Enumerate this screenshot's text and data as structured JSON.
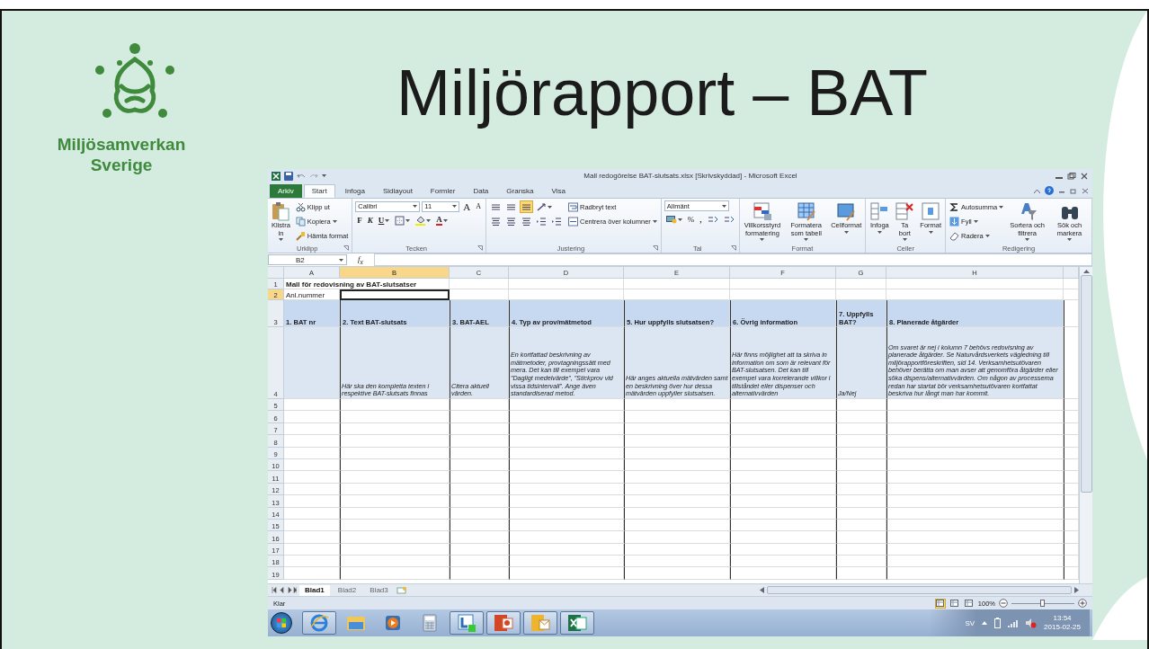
{
  "slide": {
    "logo_lines": [
      "Miljösamverkan",
      "Sverige"
    ],
    "title": "Miljörapport – BAT"
  },
  "excel": {
    "title": "Mall redogörelse BAT-slutsats.xlsx [Skrivskyddad] - Microsoft Excel",
    "ribbon_tabs": [
      {
        "label": "Arkiv",
        "kind": "file",
        "selected": false
      },
      {
        "label": "Start",
        "kind": "tab",
        "selected": true
      },
      {
        "label": "Infoga",
        "kind": "tab",
        "selected": false
      },
      {
        "label": "Sidlayout",
        "kind": "tab",
        "selected": false
      },
      {
        "label": "Formler",
        "kind": "tab",
        "selected": false
      },
      {
        "label": "Data",
        "kind": "tab",
        "selected": false
      },
      {
        "label": "Granska",
        "kind": "tab",
        "selected": false
      },
      {
        "label": "Visa",
        "kind": "tab",
        "selected": false
      }
    ],
    "ribbon_groups": [
      {
        "label": "Urklipp",
        "launcher": true,
        "columns": [
          [
            {
              "kind": "large",
              "label": "Klistra in",
              "dropdown": true
            }
          ],
          [
            {
              "kind": "small",
              "label": "Klipp ut",
              "dropdown": false
            },
            {
              "kind": "small",
              "label": "Kopiera",
              "dropdown": true
            },
            {
              "kind": "small",
              "label": "Hämta format",
              "dropdown": false
            }
          ]
        ]
      },
      {
        "label": "Tecken",
        "launcher": true,
        "columns": [
          [
            {
              "kind": "row",
              "items": [
                {
                  "kind": "field",
                  "value": "Calibri"
                },
                {
                  "kind": "field",
                  "value": "11"
                },
                {
                  "kind": "grow",
                  "text": "A",
                  "dropdown": false
                },
                {
                  "kind": "shrink",
                  "text": "A",
                  "dropdown": false
                }
              ]
            },
            {
              "kind": "row",
              "items": [
                {
                  "kind": "bold",
                  "text": "F",
                  "dropdown": false
                },
                {
                  "kind": "italic",
                  "text": "K",
                  "dropdown": false
                },
                {
                  "kind": "underline",
                  "text": "U",
                  "dropdown": true
                },
                {
                  "kind": "borders",
                  "dropdown": true
                },
                {
                  "kind": "fill",
                  "dropdown": true
                },
                {
                  "kind": "fontcolor",
                  "text": "A",
                  "dropdown": true
                }
              ]
            }
          ]
        ]
      },
      {
        "label": "Justering",
        "launcher": true,
        "columns": [
          [
            {
              "kind": "row",
              "items": [
                {
                  "kind": "valign",
                  "selected": false
                },
                {
                  "kind": "valign",
                  "selected": false
                },
                {
                  "kind": "valign",
                  "selected": true
                },
                {
                  "kind": "orientation",
                  "dropdown": true
                }
              ]
            },
            {
              "kind": "row",
              "items": [
                {
                  "kind": "halign"
                },
                {
                  "kind": "halign"
                },
                {
                  "kind": "halign"
                },
                {
                  "kind": "indent"
                },
                {
                  "kind": "indent"
                }
              ]
            }
          ],
          [
            {
              "kind": "small",
              "label": "Radbryt text",
              "dropdown": false
            },
            {
              "kind": "small",
              "label": "Centrera över kolumner",
              "dropdown": true
            }
          ]
        ]
      },
      {
        "label": "Tal",
        "launcher": true,
        "columns": [
          [
            {
              "kind": "field",
              "value": "Allmänt"
            },
            {
              "kind": "row",
              "items": [
                {
                  "kind": "currency",
                  "dropdown": true
                },
                {
                  "kind": "percent",
                  "text": "%",
                  "dropdown": false
                },
                {
                  "kind": "comma",
                  "text": ",",
                  "dropdown": false
                },
                {
                  "kind": "decimals"
                },
                {
                  "kind": "decimals"
                }
              ]
            }
          ]
        ]
      },
      {
        "label": "Format",
        "launcher": false,
        "columns": [
          [
            {
              "kind": "large",
              "label": "Villkorsstyrd formatering",
              "dropdown": true
            }
          ],
          [
            {
              "kind": "large",
              "label": "Formatera som tabell",
              "dropdown": true
            }
          ],
          [
            {
              "kind": "large",
              "label": "Cellformat",
              "dropdown": true
            }
          ]
        ]
      },
      {
        "label": "Celler",
        "launcher": false,
        "columns": [
          [
            {
              "kind": "large",
              "label": "Infoga",
              "dropdown": true
            }
          ],
          [
            {
              "kind": "large",
              "label": "Ta bort",
              "dropdown": true
            }
          ],
          [
            {
              "kind": "large",
              "label": "Format",
              "dropdown": true
            }
          ]
        ]
      },
      {
        "label": "Redigering",
        "launcher": false,
        "columns": [
          [
            {
              "kind": "small",
              "label": "Autosumma",
              "dropdown": true
            },
            {
              "kind": "small",
              "label": "Fyll",
              "dropdown": true
            },
            {
              "kind": "small",
              "label": "Radera",
              "dropdown": true
            }
          ],
          [
            {
              "kind": "large",
              "label": "Sortera och filtrera",
              "dropdown": true
            }
          ],
          [
            {
              "kind": "large",
              "label": "Sök och markera",
              "dropdown": true
            }
          ]
        ]
      }
    ],
    "formula_bar": {
      "name_box": "B2",
      "fx": "f$_{x}$"
    },
    "sheet": {
      "columns": [
        {
          "label": "A",
          "selected": false
        },
        {
          "label": "B",
          "selected": true
        },
        {
          "label": "C",
          "selected": false
        },
        {
          "label": "D",
          "selected": false
        },
        {
          "label": "E",
          "selected": false
        },
        {
          "label": "F",
          "selected": false
        },
        {
          "label": "G",
          "selected": false
        },
        {
          "label": "H",
          "selected": false
        }
      ],
      "rows": [
        {
          "number": "1",
          "kind": "title",
          "selected": false,
          "text": "Mall för redovisning av BAT-slutsatser"
        },
        {
          "number": "2",
          "kind": "label",
          "selected": true,
          "label": "Anl.nummer"
        },
        {
          "number": "3",
          "kind": "header",
          "selected": false,
          "cells": [
            "1. BAT nr",
            "2. Text BAT-slutsats",
            "3. BAT-AEL",
            "4. Typ av prov/mätmetod",
            "5. Hur uppfylls slutsatsen?",
            "6. Övrig information",
            "7. Uppfylls BAT?",
            "8. Planerade åtgärder"
          ]
        },
        {
          "number": "4",
          "kind": "note",
          "selected": false,
          "cells": [
            "Här ska den kompletta texten i respektive BAT-slutsats finnas",
            "Citera aktuell värden.",
            "En kortfattad beskrivning av mätmetoder, provtagningssätt med mera. Det kan till exempel vara ”Dagligt medelvärde”, ”Stickprov vid vissa tidsintervall”. Ange även standardiserad metod.",
            "Här anges aktuella mätvärden samt en beskrivning över hur dessa mätvärden uppfyller slutsatsen.",
            "Här finns möjlighet att ta skriva in information om som är relevant för BAT-slutsatsen. Det kan till exempel vara korrelerande villkor i tillståndet eller dispenser och alternativvärden",
            "Ja/Nej",
            "Om svaret är nej i kolumn 7 behövs redovisning av planerade åtgärder. Se Naturvårdsverkets vägledning till miljörapportföreskriften, sid 14. Verksamhetsutövaren behöver berätta om man avser att genomföra åtgärder eller söka dispens/alternativvärden. Om någon av processerna redan har startat bör verksamhetsutövaren kortfattat beskriva hur långt man har kommit."
          ]
        },
        {
          "number": "5",
          "kind": "empty",
          "selected": false
        },
        {
          "number": "6",
          "kind": "empty",
          "selected": false
        },
        {
          "number": "7",
          "kind": "empty",
          "selected": false
        },
        {
          "number": "8",
          "kind": "empty",
          "selected": false
        },
        {
          "number": "9",
          "kind": "empty",
          "selected": false
        },
        {
          "number": "10",
          "kind": "empty",
          "selected": false
        },
        {
          "number": "11",
          "kind": "empty",
          "selected": false
        },
        {
          "number": "12",
          "kind": "empty",
          "selected": false
        },
        {
          "number": "13",
          "kind": "empty",
          "selected": false
        },
        {
          "number": "14",
          "kind": "empty",
          "selected": false
        },
        {
          "number": "15",
          "kind": "empty",
          "selected": false
        },
        {
          "number": "16",
          "kind": "empty",
          "selected": false
        },
        {
          "number": "17",
          "kind": "empty",
          "selected": false
        },
        {
          "number": "18",
          "kind": "empty",
          "selected": false
        },
        {
          "number": "19",
          "kind": "empty",
          "selected": false
        }
      ]
    },
    "sheet_tabs": [
      {
        "label": "Blad1",
        "selected": true
      },
      {
        "label": "Blad2",
        "selected": false
      },
      {
        "label": "Blad3",
        "selected": false
      }
    ],
    "status_bar": {
      "text": "Klar",
      "views": [
        {
          "selected": true
        },
        {
          "selected": false
        },
        {
          "selected": false
        }
      ],
      "zoom": "100%",
      "zoom_slider": {
        "level": 0.5
      }
    }
  },
  "taskbar": {
    "apps": [
      {
        "kind": "ie",
        "running": true
      },
      {
        "kind": "explorer",
        "running": false
      },
      {
        "kind": "media",
        "running": false
      },
      {
        "kind": "calculator",
        "running": false
      },
      {
        "kind": "lync",
        "running": true
      },
      {
        "kind": "powerpoint",
        "running": true
      },
      {
        "kind": "outlook",
        "running": true
      },
      {
        "kind": "excel",
        "running": true
      }
    ],
    "language": "SV",
    "time": "13:54",
    "date": "2015-02-25"
  }
}
